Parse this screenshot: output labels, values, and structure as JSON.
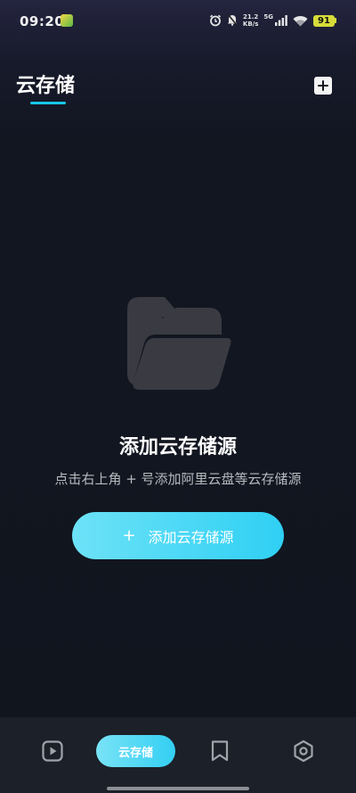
{
  "status_bar": {
    "time": "09:20",
    "net_speed_value": "21.2",
    "net_speed_unit": "KB/s",
    "net_type": "5G",
    "battery_level": "91"
  },
  "header": {
    "title": "云存储"
  },
  "empty_state": {
    "title": "添加云存储源",
    "description": "点击右上角 + 号添加阿里云盘等云存储源",
    "button_plus": "+",
    "button_label": "添加云存储源"
  },
  "bottom_nav": {
    "items": [
      {
        "icon": "play-icon",
        "label": ""
      },
      {
        "icon": "",
        "label": "云存储"
      },
      {
        "icon": "bookmark-icon",
        "label": ""
      },
      {
        "icon": "settings-icon",
        "label": ""
      }
    ]
  },
  "colors": {
    "accent": "#19c6e6",
    "button_gradient_start": "#6de2f7",
    "button_gradient_end": "#2fd0f4",
    "background": "#11151e",
    "nav_background": "#1c2029",
    "folder_icon": "#3a3b42"
  }
}
